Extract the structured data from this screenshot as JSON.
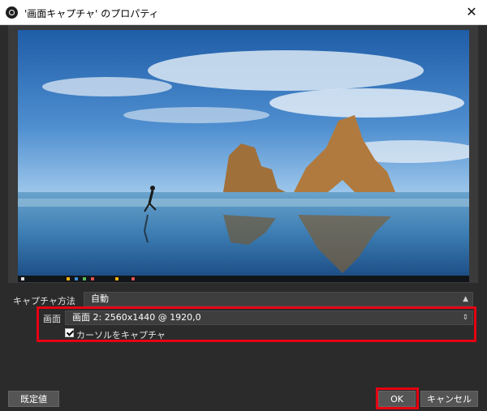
{
  "window": {
    "title": "'画面キャプチャ' のプロパティ"
  },
  "icons": {
    "app": "obs-icon",
    "close": "close-icon",
    "dropdown": "chevron-down-icon"
  },
  "capture_method": {
    "label": "キャプチャ方法",
    "value": "自動"
  },
  "display": {
    "label": "画面",
    "value": "画面 2: 2560x1440 @ 1920,0"
  },
  "cursor": {
    "label": "カーソルをキャプチャ",
    "checked": true
  },
  "buttons": {
    "defaults": "既定値",
    "ok": "OK",
    "cancel": "キャンセル"
  },
  "colors": {
    "highlight": "#e60012",
    "background": "#2b2b2b"
  }
}
